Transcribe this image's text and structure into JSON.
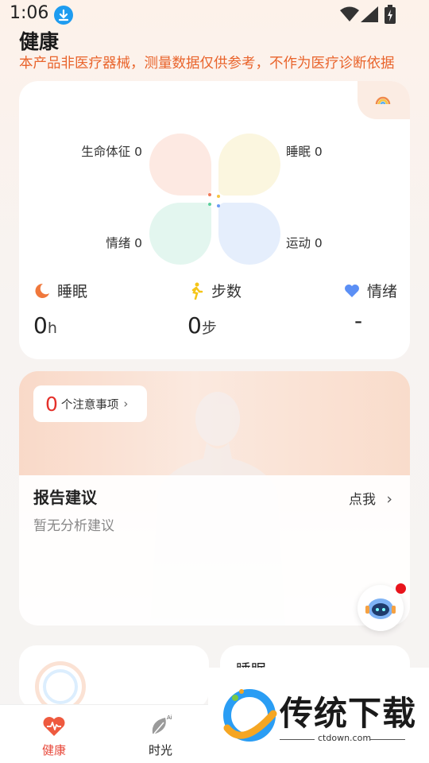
{
  "status_bar": {
    "time": "1:06"
  },
  "header": {
    "title": "健康",
    "disclaimer": "本产品非医疗器械，测量数据仅供参考，不作为医疗诊断依据"
  },
  "health_card": {
    "petals": {
      "vital": "生命体征 0",
      "sleep": "睡眠 0",
      "mood": "情绪 0",
      "sport": "运动 0"
    },
    "metrics": [
      {
        "label": "睡眠",
        "value": "0",
        "unit": "h",
        "icon": "sleep-moon-icon",
        "color": "#f0783c"
      },
      {
        "label": "步数",
        "value": "0",
        "unit": "步",
        "icon": "walking-icon",
        "color": "#f5c518"
      },
      {
        "label": "情绪",
        "value": "-",
        "unit": "",
        "icon": "heart-icon",
        "color": "#5b8ff5"
      }
    ]
  },
  "report_card": {
    "notice_count": "0",
    "notice_text": "个注意事项",
    "title": "报告建议",
    "subtitle": "暂无分析建议",
    "action": "点我"
  },
  "bottom_cards": {
    "right_title": "睡眠"
  },
  "tabs": [
    {
      "label": "健康",
      "icon": "heart-pulse-icon",
      "active": true
    },
    {
      "label": "时光",
      "icon": "leaf-ai-icon",
      "active": false
    }
  ],
  "watermark": {
    "text": "传统下载",
    "url": "ctdown.com"
  },
  "colors": {
    "accent": "#e84a3c",
    "disclaimer": "#e9642c",
    "notice": "#e4312b"
  }
}
